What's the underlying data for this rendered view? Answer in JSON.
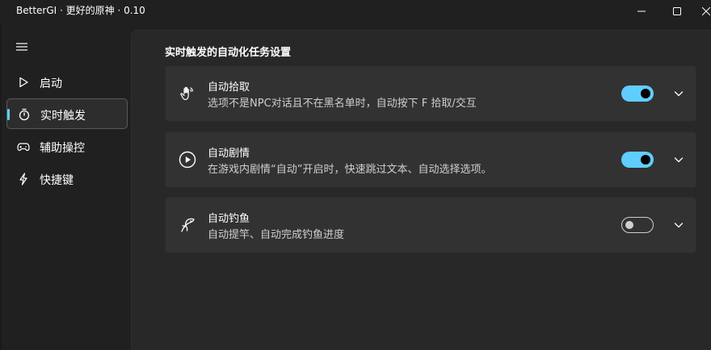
{
  "window": {
    "title": "BetterGI · 更好的原神 · 0.10"
  },
  "sidebar": {
    "items": [
      {
        "label": "启动",
        "icon": "play-icon",
        "active": false
      },
      {
        "label": "实时触发",
        "icon": "timer-icon",
        "active": true
      },
      {
        "label": "辅助操控",
        "icon": "gamepad-icon",
        "active": false
      },
      {
        "label": "快捷键",
        "icon": "flash-icon",
        "active": false
      }
    ]
  },
  "main": {
    "section_title": "实时触发的自动化任务设置",
    "cards": [
      {
        "title": "自动拾取",
        "description": "选项不是NPC对话且不在黑名单时，自动按下 F 拾取/交互",
        "icon": "hand-wave-icon",
        "enabled": true
      },
      {
        "title": "自动剧情",
        "description": "在游戏内剧情“自动”开启时，快速跳过文本、自动选择选项。",
        "icon": "play-circle-icon",
        "enabled": true
      },
      {
        "title": "自动钓鱼",
        "description": "自动提竿、自动完成钓鱼进度",
        "icon": "fish-icon",
        "enabled": false
      }
    ]
  },
  "colors": {
    "accent": "#60cdff",
    "background": "#202020",
    "content": "#282828",
    "card": "#323232"
  }
}
